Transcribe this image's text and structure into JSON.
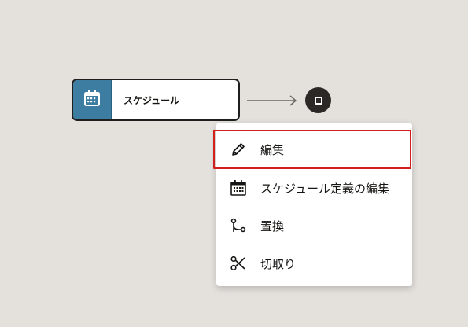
{
  "canvas": {
    "background": "#e4e1dd"
  },
  "node": {
    "label": "スケジュール",
    "icon": "calendar-icon",
    "accent_color": "#3d7da1"
  },
  "end_node": {
    "icon": "stop-icon"
  },
  "context_menu": {
    "highlight_color": "#d1201c",
    "items": [
      {
        "label": "編集",
        "icon": "pencil-icon",
        "highlighted": true
      },
      {
        "label": "スケジュール定義の編集",
        "icon": "calendar-icon",
        "highlighted": false
      },
      {
        "label": "置換",
        "icon": "branch-icon",
        "highlighted": false
      },
      {
        "label": "切取り",
        "icon": "scissors-icon",
        "highlighted": false
      }
    ]
  }
}
